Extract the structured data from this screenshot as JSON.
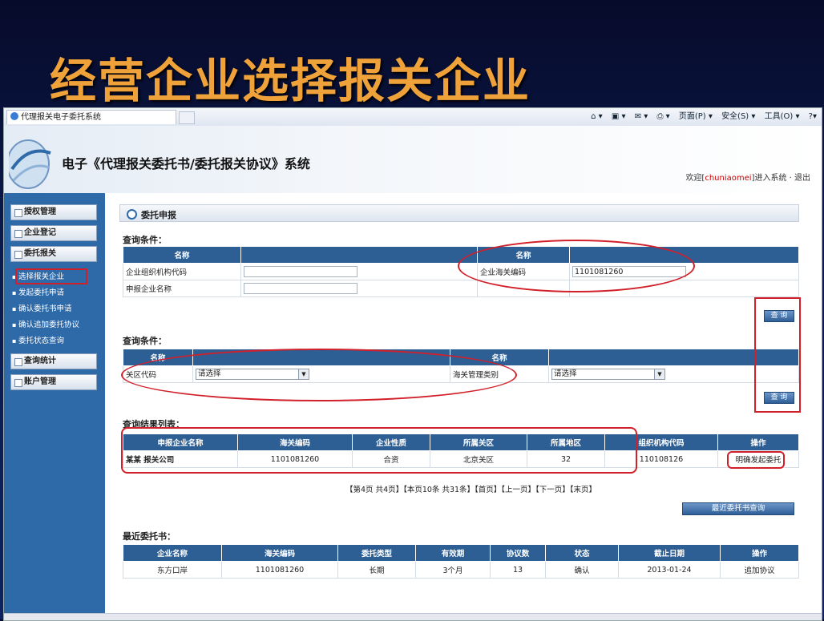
{
  "slide_title": "经营企业选择报关企业",
  "browser": {
    "tab_title": "代理报关电子委托系统",
    "toolbar": [
      "页面(P) ▾",
      "安全(S) ▾",
      "工具(O) ▾",
      "?▾"
    ]
  },
  "header": {
    "app_title": "电子《代理报关委托书/委托报关协议》系统",
    "welcome_prefix": "欢迎[",
    "username": "chuniaomei",
    "welcome_suffix": "]进入系统 · 退出"
  },
  "sidebar": {
    "sections": [
      "授权管理",
      "企业登记",
      "委托报关",
      "查询统计",
      "账户管理"
    ],
    "sub_items": [
      "选择报关企业",
      "发起委托申请",
      "确认委托书申请",
      "确认追加委托协议",
      "委托状态查询"
    ]
  },
  "panel_title": "委托申报",
  "query1": {
    "label": "查询条件：",
    "header_left": "名称",
    "header_right": "名称",
    "row1_label": "企业组织机构代码",
    "row2_label": "申报企业名称",
    "customs_code_label": "企业海关编码",
    "customs_code_value": "1101081260",
    "button": "查 询"
  },
  "query2": {
    "label": "查询条件：",
    "header_left": "名称",
    "header_right": "名称",
    "field1_label": "关区代码",
    "field1_value": "请选择",
    "field2_label": "海关管理类别",
    "field2_value": "请选择",
    "button": "查 询"
  },
  "results": {
    "label": "查询结果列表：",
    "columns": [
      "申报企业名称",
      "海关编码",
      "企业性质",
      "所属关区",
      "所属地区",
      "组织机构代码",
      "操作"
    ],
    "row": [
      "某某 报关公司",
      "1101081260",
      "合资",
      "北京关区",
      "32",
      "110108126",
      "明确发起委托"
    ]
  },
  "pager": "【第4页 共4页】【本页10条 共31条】【首页】【上一页】【下一页】【末页】",
  "recent_button": "最近委托书查询",
  "recent": {
    "label": "最近委托书：",
    "columns": [
      "企业名称",
      "海关编码",
      "委托类型",
      "有效期",
      "协议数",
      "状态",
      "截止日期",
      "操作"
    ],
    "row": [
      "东方口岸",
      "1101081260",
      "长期",
      "3个月",
      "13",
      "确认",
      "2013-01-24",
      "追加协议"
    ]
  }
}
